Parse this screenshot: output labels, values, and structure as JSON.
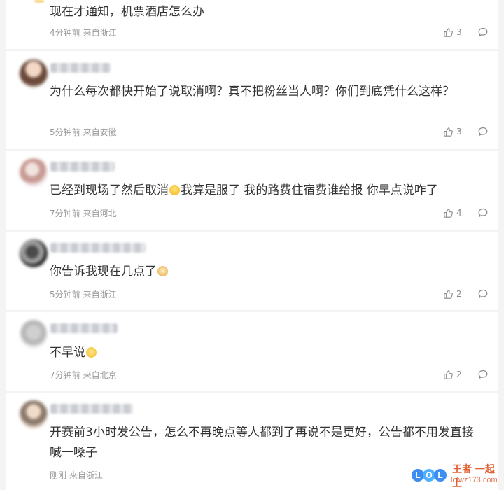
{
  "like_icon": "thumbs-up-icon",
  "reply_icon": "comment-bubble-icon",
  "comments": [
    {
      "text": "现在才通知，机票酒店怎么办",
      "time": "4分钟前",
      "location": "来自浙江",
      "likes": "3"
    },
    {
      "text": "为什么每次都快开始了说取消啊？真不把粉丝当人啊？你们到底凭什么这样？",
      "time": "5分钟前",
      "location": "来自安徽",
      "likes": "3"
    },
    {
      "text_before": "已经到现场了然后取消",
      "emoji": "laugh-emoji",
      "text_after": "我算是服了 我的路费住宿费谁给报 你早点说咋了",
      "time": "7分钟前",
      "location": "来自河北",
      "likes": "4"
    },
    {
      "text_before": "你告诉我现在几点了",
      "emoji": "cat-emoji",
      "time": "5分钟前",
      "location": "来自浙江",
      "likes": "2"
    },
    {
      "text_before": "不早说",
      "emoji": "sleepy-emoji",
      "time": "7分钟前",
      "location": "来自北京",
      "likes": "2"
    },
    {
      "text": "开赛前3小时发公告，怎么不再晚点等人都到了再说不是更好，公告都不用发直接喊一嗓子",
      "time": "刚刚",
      "location": "来自浙江"
    }
  ],
  "watermark": {
    "letters": [
      "L",
      "O",
      "L"
    ],
    "top": "王者 一起上",
    "url": "lolwz173.com"
  }
}
